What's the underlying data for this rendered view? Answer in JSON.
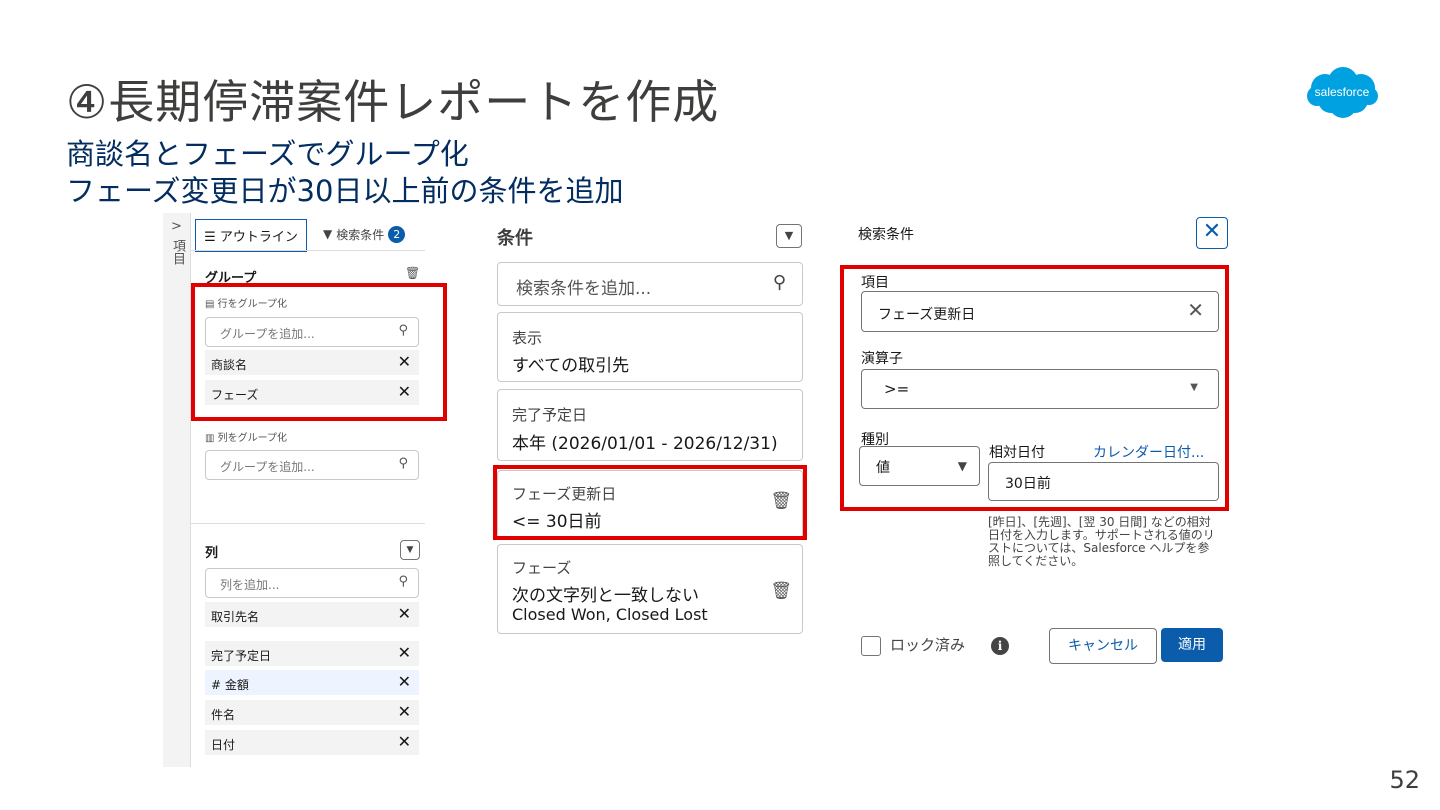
{
  "slide": {
    "title": "④長期停滞案件レポートを作成",
    "subtitle_1": "商談名とフェーズでグループ化",
    "subtitle_2": "フェーズ変更日が30日以上前の条件を追加",
    "page_number": "52",
    "logo_text": "salesforce"
  },
  "left_panel": {
    "strip_chevron": ">",
    "strip_label": "項目",
    "tab_outline": "☰ アウトライン",
    "tab_filters": "検索条件",
    "filter_count": "2",
    "groups_title": "グループ",
    "row_group_label": "行をグループ化",
    "add_group_placeholder": "グループを追加...",
    "row_groups": [
      "商談名",
      "フェーズ"
    ],
    "column_group_label": "列をグループ化",
    "add_column_group_placeholder": "グループを追加...",
    "columns_title": "列",
    "add_column_placeholder": "列を追加...",
    "columns": [
      "取引先名",
      "完了予定日",
      "# 金額",
      "件名",
      "日付"
    ]
  },
  "conditions": {
    "title": "条件",
    "add_filter_placeholder": "検索条件を追加...",
    "cards": [
      {
        "header": "表示",
        "value": "すべての取引先"
      },
      {
        "header": "完了予定日",
        "value": "本年 (2026/01/01 - 2026/12/31)"
      },
      {
        "header": "フェーズ更新日",
        "value": "<= 30日前"
      },
      {
        "header": "フェーズ",
        "value": "次の文字列と一致しない",
        "value2": "Closed Won, Closed Lost"
      }
    ]
  },
  "filter_editor": {
    "title": "検索条件",
    "field_label": "項目",
    "field_value": "フェーズ更新日",
    "operator_label": "演算子",
    "operator_value": ">=",
    "type_label": "種別",
    "type_value": "値",
    "relative_tab": "相対日付",
    "calendar_tab": "カレンダー日付...",
    "relative_value": "30日前",
    "help_text": "[昨日]、[先週]、[翌 30 日間] などの相対日付を入力します。サポートされる値のリストについては、Salesforce ヘルプを参照してください。",
    "locked_label": "ロック済み",
    "cancel_label": "キャンセル",
    "apply_label": "適用"
  },
  "colors": {
    "accent": "#0b5cab",
    "highlight": "#e00000",
    "title": "#032d60"
  }
}
